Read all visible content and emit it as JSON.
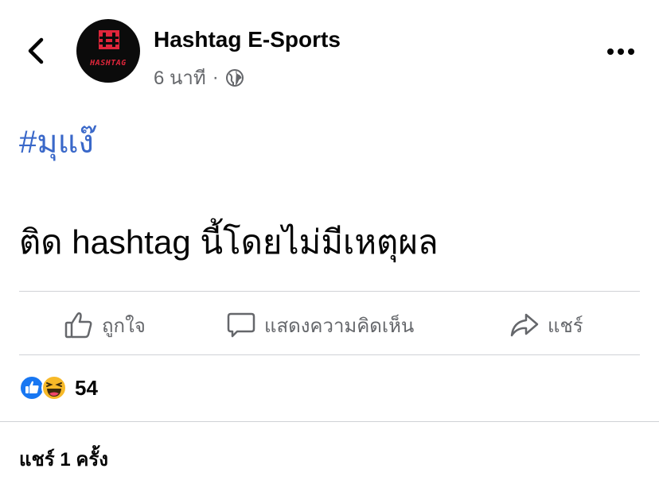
{
  "post": {
    "page_name": "Hashtag E-Sports",
    "avatar_text": "HASHTAG",
    "time": "6 นาที",
    "separator": "·",
    "hashtag": "#มุแง๊",
    "text": "ติด hashtag นี้โดยไม่มีเหตุผล"
  },
  "actions": {
    "like": "ถูกใจ",
    "comment": "แสดงความคิดเห็น",
    "share": "แชร์"
  },
  "reactions": {
    "count": "54",
    "types": [
      "like-icon",
      "haha-icon"
    ]
  },
  "shares": {
    "label": "แชร์ 1 ครั้ง"
  },
  "colors": {
    "link": "#3a68c9",
    "secondary": "#65676b",
    "like_blue": "#1877f2",
    "avatar_red": "#e0263b"
  }
}
